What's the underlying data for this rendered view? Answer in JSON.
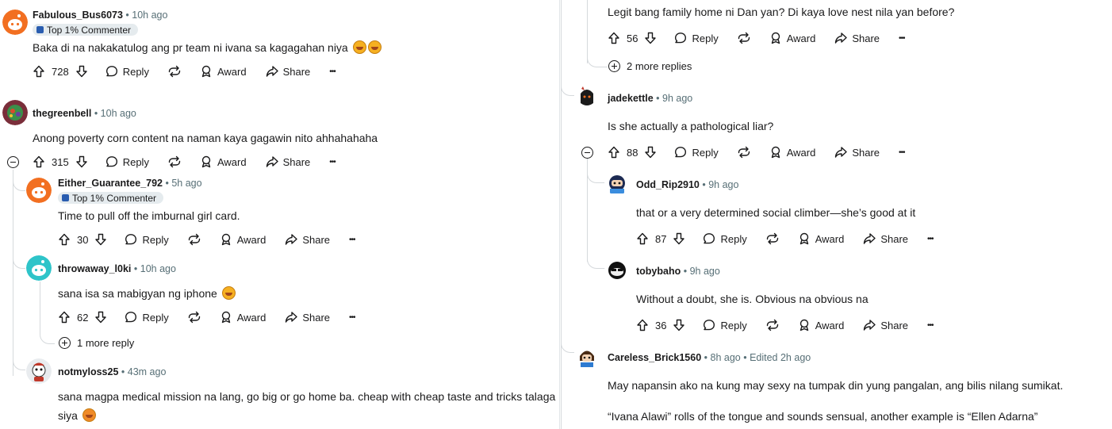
{
  "labels": {
    "reply": "Reply",
    "award": "Award",
    "share": "Share",
    "more_options": "•••"
  },
  "colors": {
    "text": "#1a1a1b",
    "meta": "#576f76",
    "thread_line": "#d5d9dc",
    "flair_bg": "#e5ebee"
  },
  "left": {
    "c1": {
      "username": "Fabulous_Bus6073",
      "time": "• 10h ago",
      "flair": "Top 1% Commenter",
      "body": "Baka di na nakakatulog ang pr team ni ivana sa kagagahan niya",
      "votes": "728"
    },
    "c2": {
      "username": "thegreenbell",
      "time": "• 10h ago",
      "body": "Anong poverty corn content na naman kaya gagawin nito ahhahahaha",
      "votes": "315"
    },
    "c3": {
      "username": "Either_Guarantee_792",
      "time": "• 5h ago",
      "flair": "Top 1% Commenter",
      "body": "Time to pull off the imburnal girl card.",
      "votes": "30"
    },
    "c4": {
      "username": "throwaway_l0ki",
      "time": "• 10h ago",
      "body": "sana isa sa mabigyan ng iphone",
      "votes": "62",
      "more_replies": "1 more reply"
    },
    "c5": {
      "username": "notmyloss25",
      "time": "• 43m ago",
      "body": "sana magpa medical mission na lang, go big or go home ba. cheap with cheap taste and tricks talaga siya"
    }
  },
  "right": {
    "c0": {
      "body": "Legit bang family home ni Dan yan? Di kaya love nest nila yan before?",
      "votes": "56",
      "more_replies": "2 more replies"
    },
    "c1": {
      "username": "jadekettle",
      "time": "• 9h ago",
      "body": "Is she actually a pathological liar?",
      "votes": "88"
    },
    "c2": {
      "username": "Odd_Rip2910",
      "time": "• 9h ago",
      "body": "that or a very determined social climber—she’s good at it",
      "votes": "87"
    },
    "c3": {
      "username": "tobybaho",
      "time": "• 9h ago",
      "body": "Without a doubt, she is. Obvious na obvious na",
      "votes": "36"
    },
    "c4": {
      "username": "Careless_Brick1560",
      "time": "• 8h ago",
      "edited": "• Edited 2h ago",
      "body1": "May napansin ako na kung may sexy na tumpak din yung pangalan, ang bilis nilang sumikat.",
      "body2": "“Ivana Alawi” rolls of the tongue and sounds sensual, another example is “Ellen Adarna”"
    }
  }
}
